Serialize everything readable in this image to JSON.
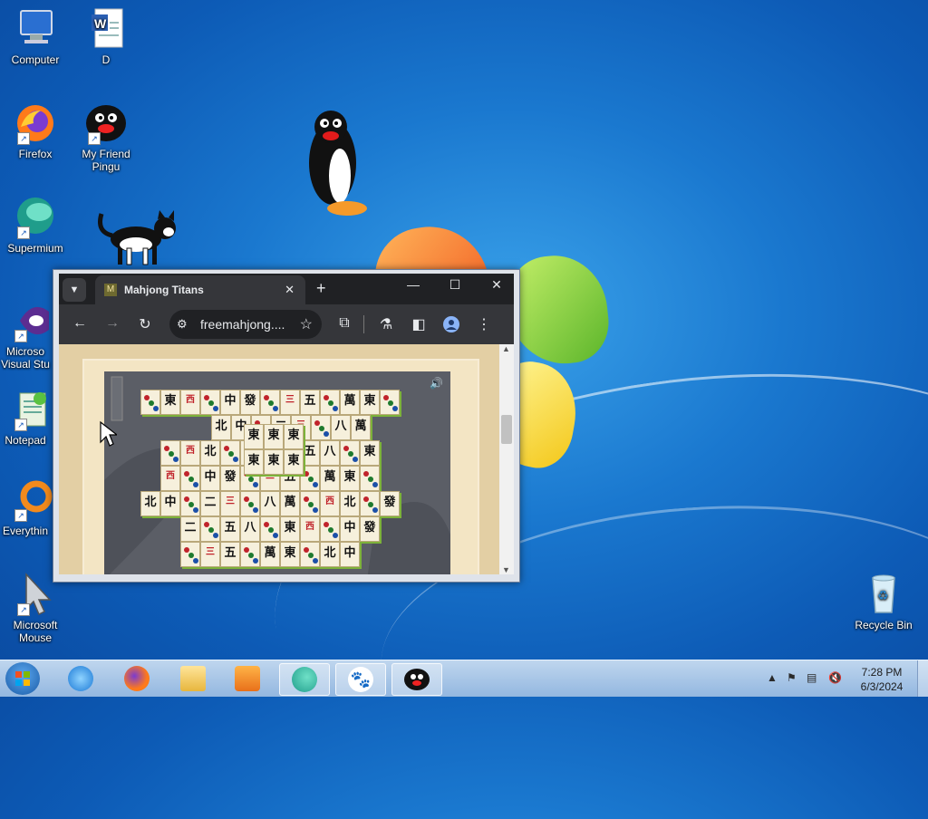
{
  "desktop": {
    "icons": [
      {
        "label": "Computer",
        "icon": "computer-icon"
      },
      {
        "label": "D",
        "icon": "word-document-icon"
      },
      {
        "label": "Firefox",
        "icon": "firefox-icon"
      },
      {
        "label": "My Friend Pingu",
        "icon": "pingu-icon"
      },
      {
        "label": "Supermium",
        "icon": "supermium-icon"
      },
      {
        "label": "Microso Visual Stu",
        "icon": "visual-studio-icon"
      },
      {
        "label": "Notepad",
        "icon": "notepad-icon"
      },
      {
        "label": "Everythin",
        "icon": "everything-icon"
      },
      {
        "label": "Microsoft Mouse",
        "icon": "mouse-cursor-icon"
      },
      {
        "label": "Recycle Bin",
        "icon": "recycle-bin-icon"
      }
    ]
  },
  "browser": {
    "tab_title": "Mahjong Titans",
    "tab_favicon": "M",
    "tab_close": "✕",
    "new_tab": "+",
    "minimize": "—",
    "maximize": "☐",
    "close": "✕",
    "url": "freemahjong....",
    "nav": {
      "back": "←",
      "forward": "→",
      "reload": "↻"
    }
  },
  "game": {
    "title": "Mahjong Titans",
    "sound_icon": "speaker-icon"
  },
  "taskbar": {
    "clock_time": "7:28 PM",
    "clock_date": "6/3/2024",
    "pinned": [
      "internet-explorer-icon",
      "firefox-icon",
      "file-explorer-icon",
      "media-player-icon",
      "supermium-icon",
      "paw-icon",
      "pingu-icon"
    ]
  },
  "colors": {
    "desktop_blue": "#1a78cf",
    "browser_dark": "#35363a",
    "tile_highlight": "#7db23a"
  }
}
